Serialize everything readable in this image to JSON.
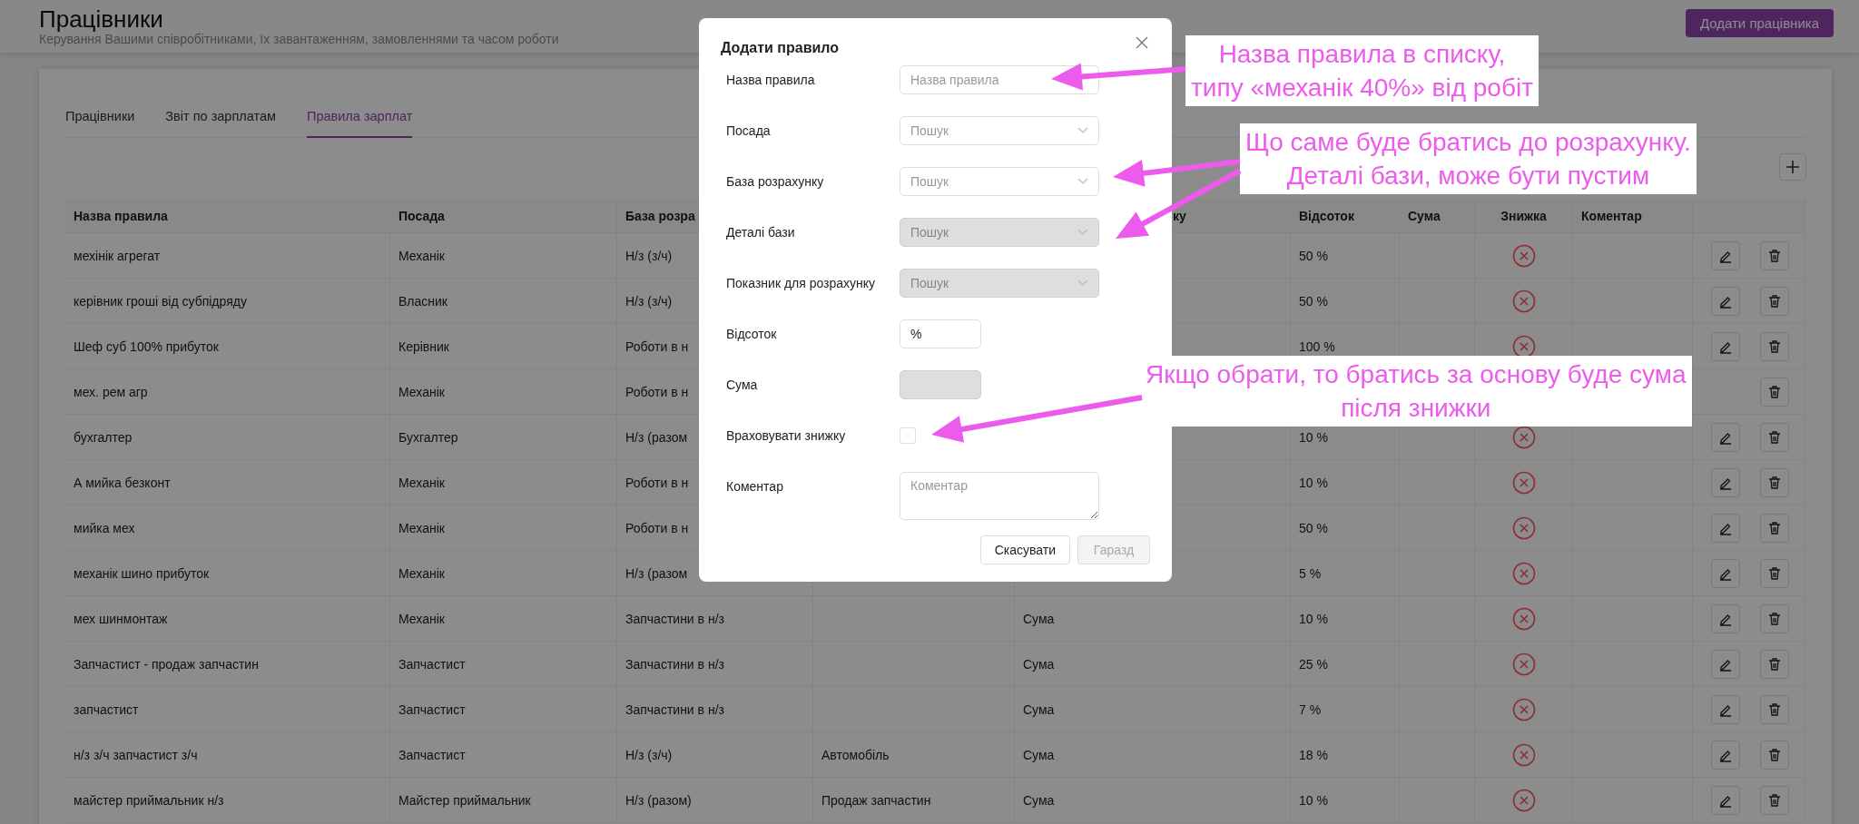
{
  "header": {
    "title": "Працівники",
    "subtitle": "Керування Вашими співробітниками, їх завантаженням, замовленнями та часом роботи",
    "add_button": "Додати працівника"
  },
  "tabs": [
    {
      "label": "Працівники",
      "selected": false
    },
    {
      "label": "Звіт по зарплатам",
      "selected": false
    },
    {
      "label": "Правила зарплат",
      "selected": true
    }
  ],
  "table": {
    "columns": [
      "Назва правила",
      "Посада",
      "База розра",
      null,
      "ку",
      "Відсоток",
      "Сума",
      "Знижка",
      "Коментар",
      null
    ],
    "rows": [
      {
        "name": "мехінік агрегат",
        "position": "Механік",
        "base": "Н/з (з/ч)",
        "percent": "50 %",
        "discount": false,
        "actions": [
          {
            "kind": "edit"
          },
          {
            "kind": "delete"
          }
        ]
      },
      {
        "name": "керівник гроші від субпідряду",
        "position": "Власник",
        "base": "Н/з (з/ч)",
        "percent": "50 %",
        "discount": false,
        "actions": [
          {
            "kind": "edit"
          },
          {
            "kind": "delete"
          }
        ]
      },
      {
        "name": "Шеф суб 100% прибуток",
        "position": "Керівник",
        "base": "Роботи в н",
        "percent": "100 %",
        "discount": false,
        "actions": [
          {
            "kind": "edit"
          },
          {
            "kind": "delete"
          }
        ]
      },
      {
        "name": "мех. рем агр",
        "position": "Механік",
        "base": "Роботи в н",
        "actions": [
          {
            "kind": "delete"
          }
        ]
      },
      {
        "name": "бухгалтер",
        "position": "Бухгалтер",
        "base": "Н/з (разом",
        "percent": "10 %",
        "discount": false,
        "actions": [
          {
            "kind": "edit"
          },
          {
            "kind": "delete"
          }
        ]
      },
      {
        "name": "А мийка безконт",
        "position": "Механік",
        "base": "Роботи в н",
        "percent": "10 %",
        "discount": false,
        "actions": [
          {
            "kind": "edit"
          },
          {
            "kind": "delete"
          }
        ]
      },
      {
        "name": "мийка мех",
        "position": "Механік",
        "base": "Роботи в н",
        "percent": "50 %",
        "discount": false,
        "actions": [
          {
            "kind": "edit"
          },
          {
            "kind": "delete"
          }
        ]
      },
      {
        "name": "механік шино прибуток",
        "position": "Механік",
        "base": "Н/з (разом",
        "percent": "5 %",
        "discount": false,
        "actions": [
          {
            "kind": "edit"
          },
          {
            "kind": "delete"
          }
        ]
      },
      {
        "name": "мех шинмонтаж",
        "position": "Механік",
        "base": "Запчастини в н/з",
        "indicator": "Сума",
        "percent": "10 %",
        "discount": false,
        "actions": [
          {
            "kind": "edit"
          },
          {
            "kind": "delete"
          }
        ]
      },
      {
        "name": "Запчастист - продаж запчастин",
        "position": "Запчастист",
        "base": "Запчастини в н/з",
        "indicator": "Сума",
        "percent": "25 %",
        "discount": false,
        "actions": [
          {
            "kind": "edit"
          },
          {
            "kind": "delete"
          }
        ]
      },
      {
        "name": "запчастист",
        "position": "Запчастист",
        "base": "Запчастини в н/з",
        "indicator": "Сума",
        "percent": "7 %",
        "discount": false,
        "actions": [
          {
            "kind": "edit"
          },
          {
            "kind": "delete"
          }
        ]
      },
      {
        "name": "н/з з/ч запчастист з/ч",
        "position": "Запчастист",
        "base": "Н/з (з/ч)",
        "base_details": "Автомобіль",
        "indicator": "Сума",
        "percent": "18 %",
        "discount": false,
        "actions": [
          {
            "kind": "edit"
          },
          {
            "kind": "delete"
          }
        ]
      },
      {
        "name": "майстер приймальник н/з",
        "position": "Майстер приймальник",
        "base": "Н/з (разом)",
        "base_details": "Продаж запчастин",
        "indicator": "Сума",
        "percent": "10 %",
        "discount": false,
        "actions": [
          {
            "kind": "edit"
          },
          {
            "kind": "delete"
          }
        ]
      }
    ]
  },
  "modal": {
    "title": "Додати правило",
    "fields": [
      {
        "kind": "text",
        "label": "Назва правила",
        "placeholder": "Назва правила"
      },
      {
        "kind": "select",
        "label": "Посада",
        "placeholder": "Пошук",
        "disabled": false
      },
      {
        "kind": "select",
        "label": "База розрахунку",
        "placeholder": "Пошук",
        "disabled": false
      },
      {
        "kind": "select",
        "label": "Деталі бази",
        "placeholder": "Пошук",
        "disabled": true
      },
      {
        "kind": "select",
        "label": "Показник для розрахунку",
        "placeholder": "Пошук",
        "disabled": true
      },
      {
        "kind": "number",
        "label": "Відсоток",
        "value": "%",
        "disabled": false
      },
      {
        "kind": "number",
        "label": "Сума",
        "disabled": true
      },
      {
        "kind": "checkbox",
        "label": "Враховувати знижку",
        "checked": false
      },
      {
        "kind": "textarea",
        "label": "Коментар",
        "placeholder": "Коментар"
      }
    ],
    "buttons": [
      {
        "label": "Скасувати",
        "disabled": false
      },
      {
        "label": "Гаразд",
        "disabled": true
      }
    ]
  },
  "annotations": [
    {
      "lines": [
        "Назва правила в списку,",
        "типу «механік 40%» від робіт"
      ]
    },
    {
      "lines": [
        "Що саме буде братись до розрахунку.",
        "Деталі бази, може бути пустим"
      ]
    },
    {
      "lines": [
        "Якщо обрати, то братись за основу буде сума",
        "після знижки"
      ]
    }
  ]
}
